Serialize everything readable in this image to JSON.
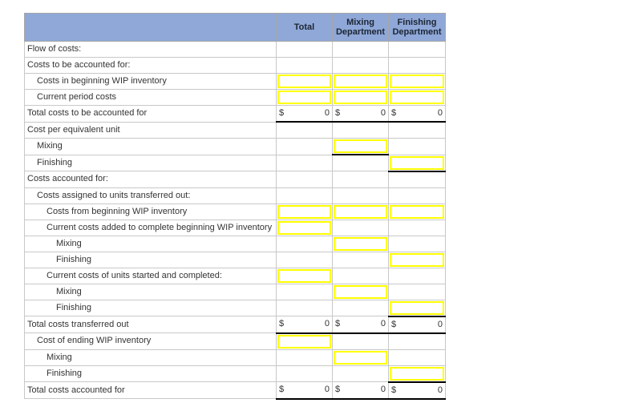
{
  "table": {
    "columns": [
      {
        "key": "label",
        "label": ""
      },
      {
        "key": "total",
        "label": "Total"
      },
      {
        "key": "mixing",
        "label": "Mixing Department"
      },
      {
        "key": "finishing",
        "label": "Finishing Department"
      }
    ],
    "header": {
      "blank": "",
      "total": "Total",
      "mixing_line1": "Mixing",
      "mixing_line2": "Department",
      "finishing_line1": "Finishing",
      "finishing_line2": "Department"
    },
    "currency_symbol": "$",
    "zero_value": "0",
    "colors": {
      "header_fill": "#8fa8d8",
      "header_border": "#a6a6a6",
      "grid_line": "#c8c8c8",
      "entry_border": "#ffff00",
      "rule": "#000000",
      "text": "#333333"
    },
    "rows": [
      {
        "label": "Flow of costs:",
        "indent": 0,
        "total": "blank",
        "mixing": "blank",
        "finishing": "blank"
      },
      {
        "label": "Costs to be accounted for:",
        "indent": 0,
        "total": "blank",
        "mixing": "blank",
        "finishing": "blank"
      },
      {
        "label": "Costs in beginning WIP inventory",
        "indent": 1,
        "total": "entry",
        "mixing": "entry",
        "finishing": "entry"
      },
      {
        "label": "Current period costs",
        "indent": 1,
        "total": "entry",
        "mixing": "entry",
        "finishing": "entry"
      },
      {
        "label": "Total costs to be accounted for",
        "indent": 0,
        "total": "money",
        "mixing": "money",
        "finishing": "money"
      },
      {
        "label": "Cost per equivalent unit",
        "indent": 0,
        "total": "blank",
        "mixing": "blank",
        "finishing": "blank"
      },
      {
        "label": "Mixing",
        "indent": 1,
        "total": "blank",
        "mixing": "entry",
        "finishing": "blank"
      },
      {
        "label": "Finishing",
        "indent": 1,
        "total": "blank",
        "mixing": "blank",
        "finishing": "entry"
      },
      {
        "label": "Costs accounted for:",
        "indent": 0,
        "total": "blank",
        "mixing": "blank",
        "finishing": "blank"
      },
      {
        "label": "Costs assigned to units transferred out:",
        "indent": 1,
        "total": "blank",
        "mixing": "blank",
        "finishing": "blank"
      },
      {
        "label": "Costs from beginning WIP inventory",
        "indent": 2,
        "total": "entry",
        "mixing": "entry",
        "finishing": "entry"
      },
      {
        "label": "Current costs added to complete beginning WIP inventory",
        "indent": 2,
        "total": "entry",
        "mixing": "blank",
        "finishing": "blank"
      },
      {
        "label": "Mixing",
        "indent": 3,
        "total": "blank",
        "mixing": "entry",
        "finishing": "blank"
      },
      {
        "label": "Finishing",
        "indent": 3,
        "total": "blank",
        "mixing": "blank",
        "finishing": "entry"
      },
      {
        "label": "Current costs of units started and completed:",
        "indent": 2,
        "total": "entry",
        "mixing": "blank",
        "finishing": "blank"
      },
      {
        "label": "Mixing",
        "indent": 3,
        "total": "blank",
        "mixing": "entry",
        "finishing": "blank"
      },
      {
        "label": "Finishing",
        "indent": 3,
        "total": "blank",
        "mixing": "blank",
        "finishing": "entry"
      },
      {
        "label": "Total costs transferred out",
        "indent": 0,
        "total": "money",
        "mixing": "money",
        "finishing": "money"
      },
      {
        "label": "Cost of ending WIP inventory",
        "indent": 1,
        "total": "entry",
        "mixing": "blank",
        "finishing": "blank"
      },
      {
        "label": "Mixing",
        "indent": 2,
        "total": "blank",
        "mixing": "entry",
        "finishing": "blank"
      },
      {
        "label": "Finishing",
        "indent": 2,
        "total": "blank",
        "mixing": "blank",
        "finishing": "entry"
      },
      {
        "label": "Total costs accounted for",
        "indent": 0,
        "total": "money",
        "mixing": "money",
        "finishing": "money"
      }
    ],
    "rules": {
      "note": "rows indices (0-based) whose cells carry a thick black bottom rule",
      "money_rows": [
        4,
        17,
        21
      ],
      "underline_cells": [
        {
          "row": 6,
          "col": "mixing"
        },
        {
          "row": 7,
          "col": "finishing"
        },
        {
          "row": 16,
          "col": "finishing"
        },
        {
          "row": 20,
          "col": "finishing"
        }
      ]
    }
  }
}
